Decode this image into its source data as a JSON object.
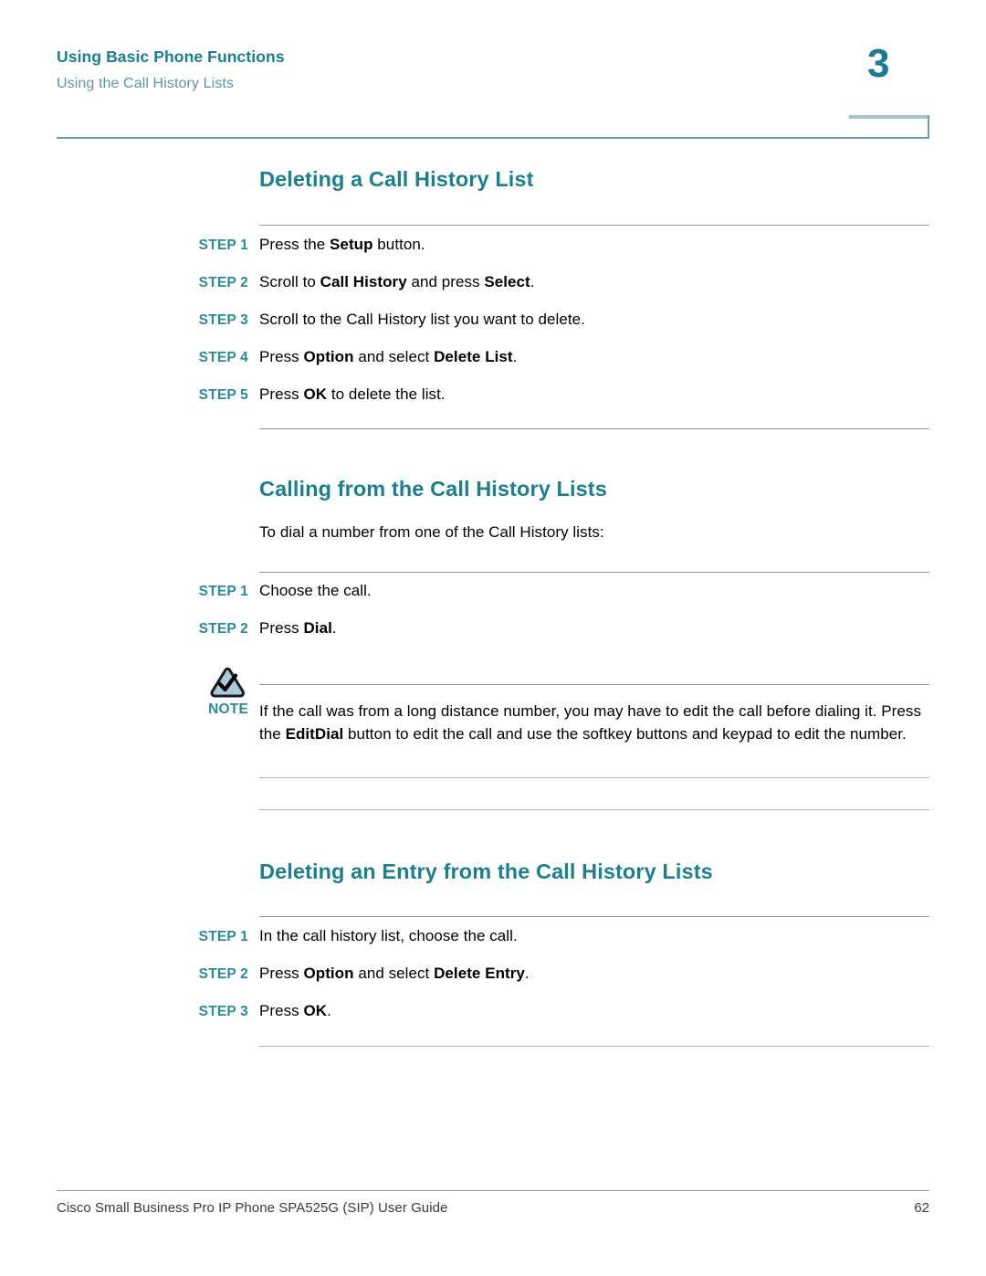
{
  "header": {
    "running_title": "Using Basic Phone Functions",
    "running_subtitle": "Using the Call History Lists",
    "chapter_number": "3"
  },
  "sections": [
    {
      "heading": "Deleting a Call History List",
      "steps": [
        {
          "label": "STEP 1",
          "text_html": "Press the <b>Setup</b> button."
        },
        {
          "label": "STEP 2",
          "text_html": "Scroll to <b>Call History</b> and press <b>Select</b>."
        },
        {
          "label": "STEP 3",
          "text_html": "Scroll to the Call History list you want to delete."
        },
        {
          "label": "STEP 4",
          "text_html": "Press <b>Option</b> and select <b>Delete List</b>."
        },
        {
          "label": "STEP 5",
          "text_html": "Press <b>OK</b> to delete the list."
        }
      ]
    },
    {
      "heading": "Calling from the Call History Lists",
      "intro": "To dial a number from one of the Call History lists:",
      "steps": [
        {
          "label": "STEP 1",
          "text_html": "Choose the call."
        },
        {
          "label": "STEP 2",
          "text_html": "Press <b>Dial</b>."
        }
      ],
      "note": {
        "label": "NOTE",
        "icon": "note-triangle-check-icon",
        "text_html": "If the call was from a long distance number, you may have to edit the call before dialing it. Press the <b>EditDial</b> button to edit the call and use the softkey buttons and keypad to edit the number."
      }
    },
    {
      "heading": "Deleting an Entry from the Call History Lists",
      "steps": [
        {
          "label": "STEP 1",
          "text_html": "In the call history list, choose the call."
        },
        {
          "label": "STEP 2",
          "text_html": "Press <b>Option</b> and select <b>Delete Entry</b>."
        },
        {
          "label": "STEP 3",
          "text_html": "Press <b>OK</b>."
        }
      ]
    }
  ],
  "footer": {
    "guide_title": "Cisco Small Business Pro IP Phone SPA525G (SIP) User Guide",
    "page_number": "62"
  },
  "colors": {
    "heading_teal": "#1a7f8e",
    "step_label_teal": "#2a8a98",
    "subtitle_teal": "#5d94a9",
    "header_rule_blue": "#6d9cc0",
    "rule_gray": "#9a9a9a"
  }
}
